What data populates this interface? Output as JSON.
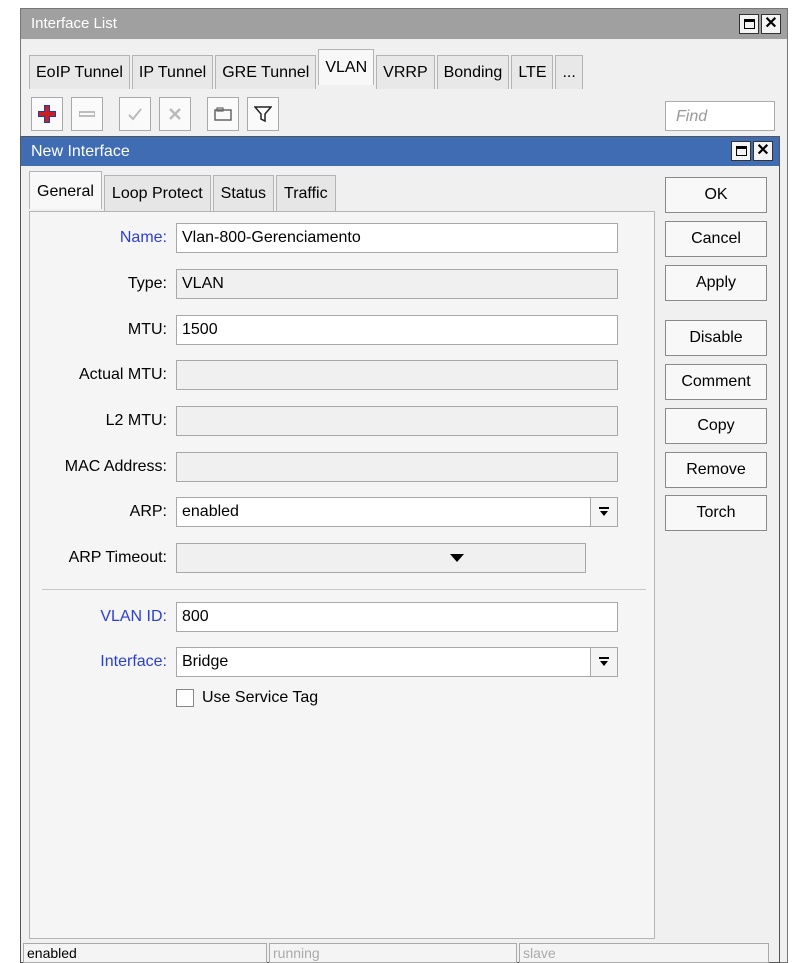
{
  "outer_window": {
    "title": "Interface List",
    "tabs": [
      "EoIP Tunnel",
      "IP Tunnel",
      "GRE Tunnel",
      "VLAN",
      "VRRP",
      "Bonding",
      "LTE",
      "..."
    ],
    "active_tab": "VLAN",
    "toolbar": {
      "icons": [
        "add-icon",
        "remove-icon",
        "enable-icon",
        "disable-icon",
        "comment-icon",
        "filter-icon"
      ]
    },
    "find_placeholder": "Find"
  },
  "dialog": {
    "title": "New Interface",
    "tabs": [
      "General",
      "Loop Protect",
      "Status",
      "Traffic"
    ],
    "active_tab": "General",
    "fields": {
      "name": {
        "label": "Name:",
        "value": "Vlan-800-Gerenciamento"
      },
      "type": {
        "label": "Type:",
        "value": "VLAN"
      },
      "mtu": {
        "label": "MTU:",
        "value": "1500"
      },
      "actual_mtu": {
        "label": "Actual MTU:",
        "value": ""
      },
      "l2_mtu": {
        "label": "L2 MTU:",
        "value": ""
      },
      "mac_address": {
        "label": "MAC Address:",
        "value": ""
      },
      "arp": {
        "label": "ARP:",
        "value": "enabled"
      },
      "arp_timeout": {
        "label": "ARP Timeout:",
        "value": ""
      },
      "vlan_id": {
        "label": "VLAN ID:",
        "value": "800"
      },
      "interface": {
        "label": "Interface:",
        "value": "Bridge"
      },
      "use_service_tag": {
        "label": "Use Service Tag",
        "checked": false
      }
    },
    "buttons": {
      "ok": "OK",
      "cancel": "Cancel",
      "apply": "Apply",
      "disable": "Disable",
      "comment": "Comment",
      "copy": "Copy",
      "remove": "Remove",
      "torch": "Torch"
    },
    "status_bar": [
      "enabled",
      "running",
      "slave"
    ]
  },
  "colors": {
    "dialog_title_bar": "#3f6cb2",
    "outer_title_bar": "#a0a0a0",
    "blue_label": "#2b3fd0"
  }
}
